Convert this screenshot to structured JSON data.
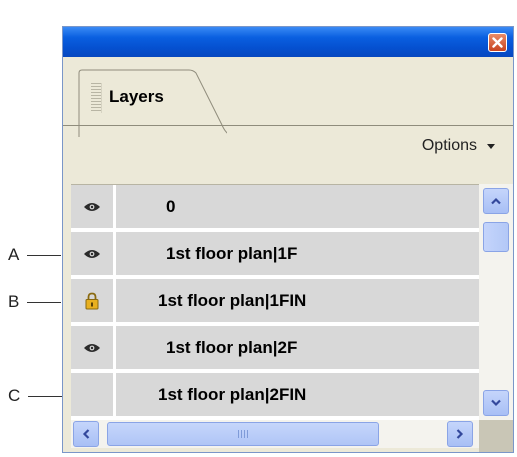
{
  "panel": {
    "tab_label": "Layers",
    "options_label": "Options",
    "close_icon": "close-icon",
    "options_icon": "chevron-down-icon"
  },
  "layers": [
    {
      "name": "0",
      "icon": "eye-icon"
    },
    {
      "name": "1st floor plan|1F",
      "icon": "eye-icon"
    },
    {
      "name": "1st floor plan|1FIN",
      "icon": "lock-icon"
    },
    {
      "name": "1st floor plan|2F",
      "icon": "eye-icon"
    },
    {
      "name": "1st floor plan|2FIN",
      "icon": ""
    }
  ],
  "callouts": [
    "A",
    "B",
    "C"
  ],
  "colors": {
    "title_bar": "#0a5fe0",
    "close_button": "#c8431f",
    "row_background": "#d8d8d8",
    "lock": "#e8b020"
  }
}
